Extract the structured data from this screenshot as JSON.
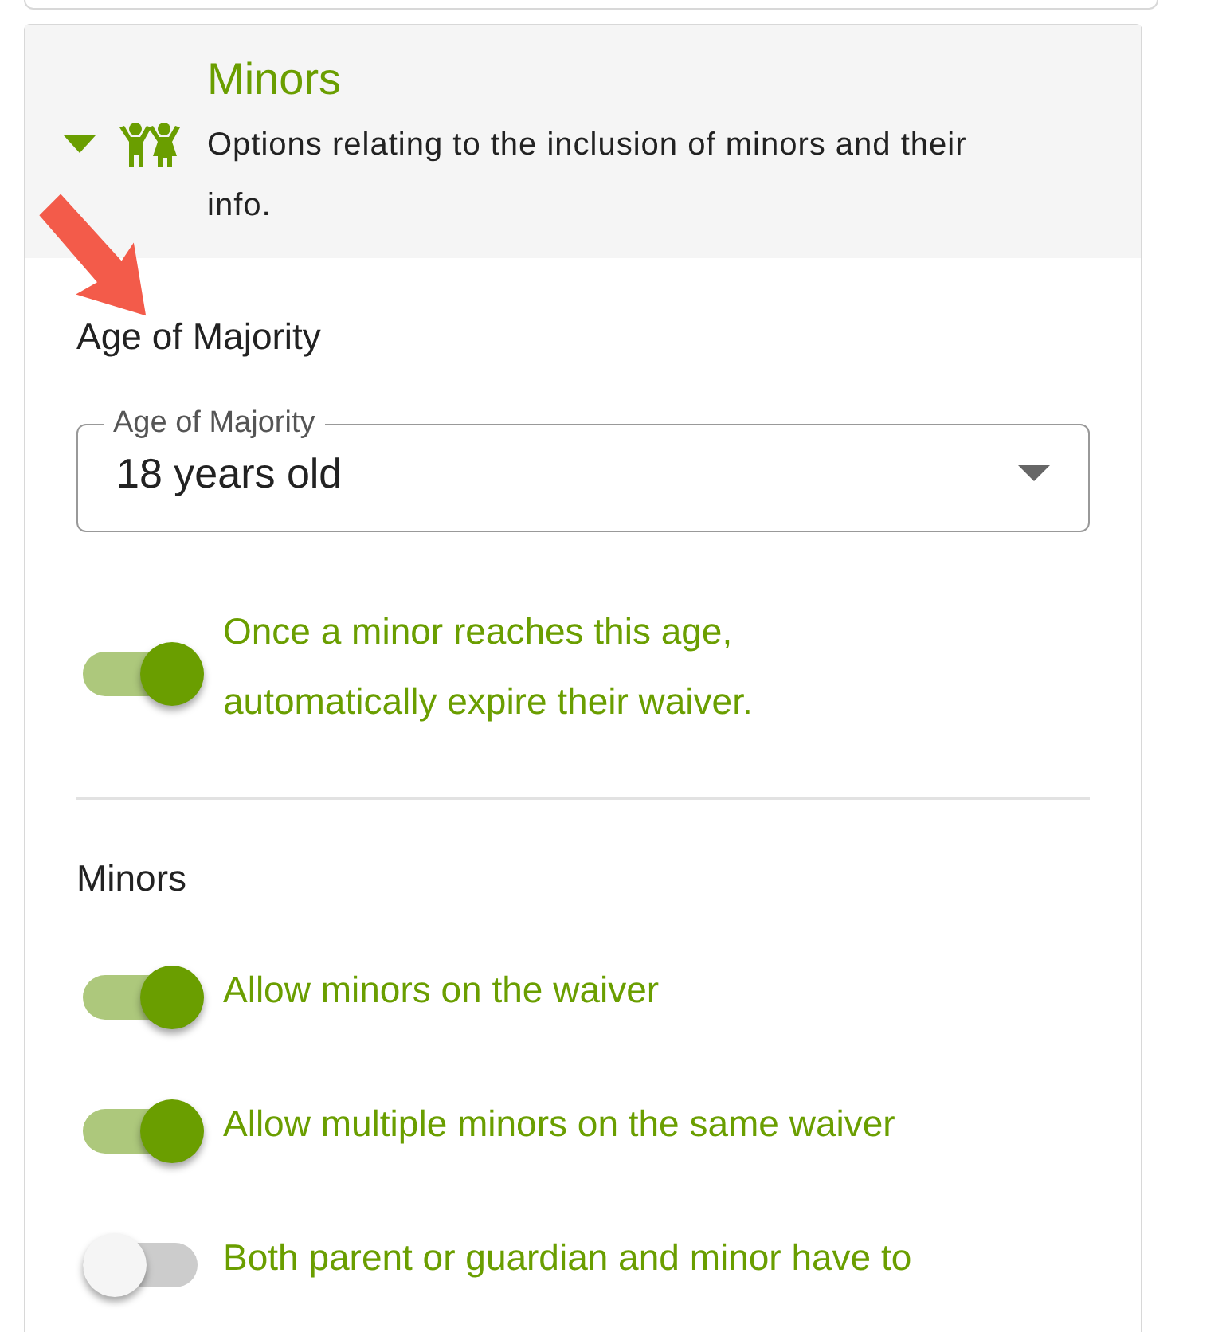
{
  "section": {
    "title": "Minors",
    "description": "Options relating to the inclusion of minors and their info.",
    "expanded": true
  },
  "groups": [
    {
      "heading": "Age of Majority",
      "select": {
        "label": "Age of Majority",
        "value": "18 years old"
      },
      "toggles": [
        {
          "label": "Once a minor reaches this age, automatically expire their waiver.",
          "on": true
        }
      ]
    },
    {
      "heading": "Minors",
      "toggles": [
        {
          "label": "Allow minors on the waiver",
          "on": true
        },
        {
          "label": "Allow multiple minors on the same waiver",
          "on": true
        },
        {
          "label": "Both parent or guardian and minor have to",
          "on": false
        }
      ]
    }
  ]
}
